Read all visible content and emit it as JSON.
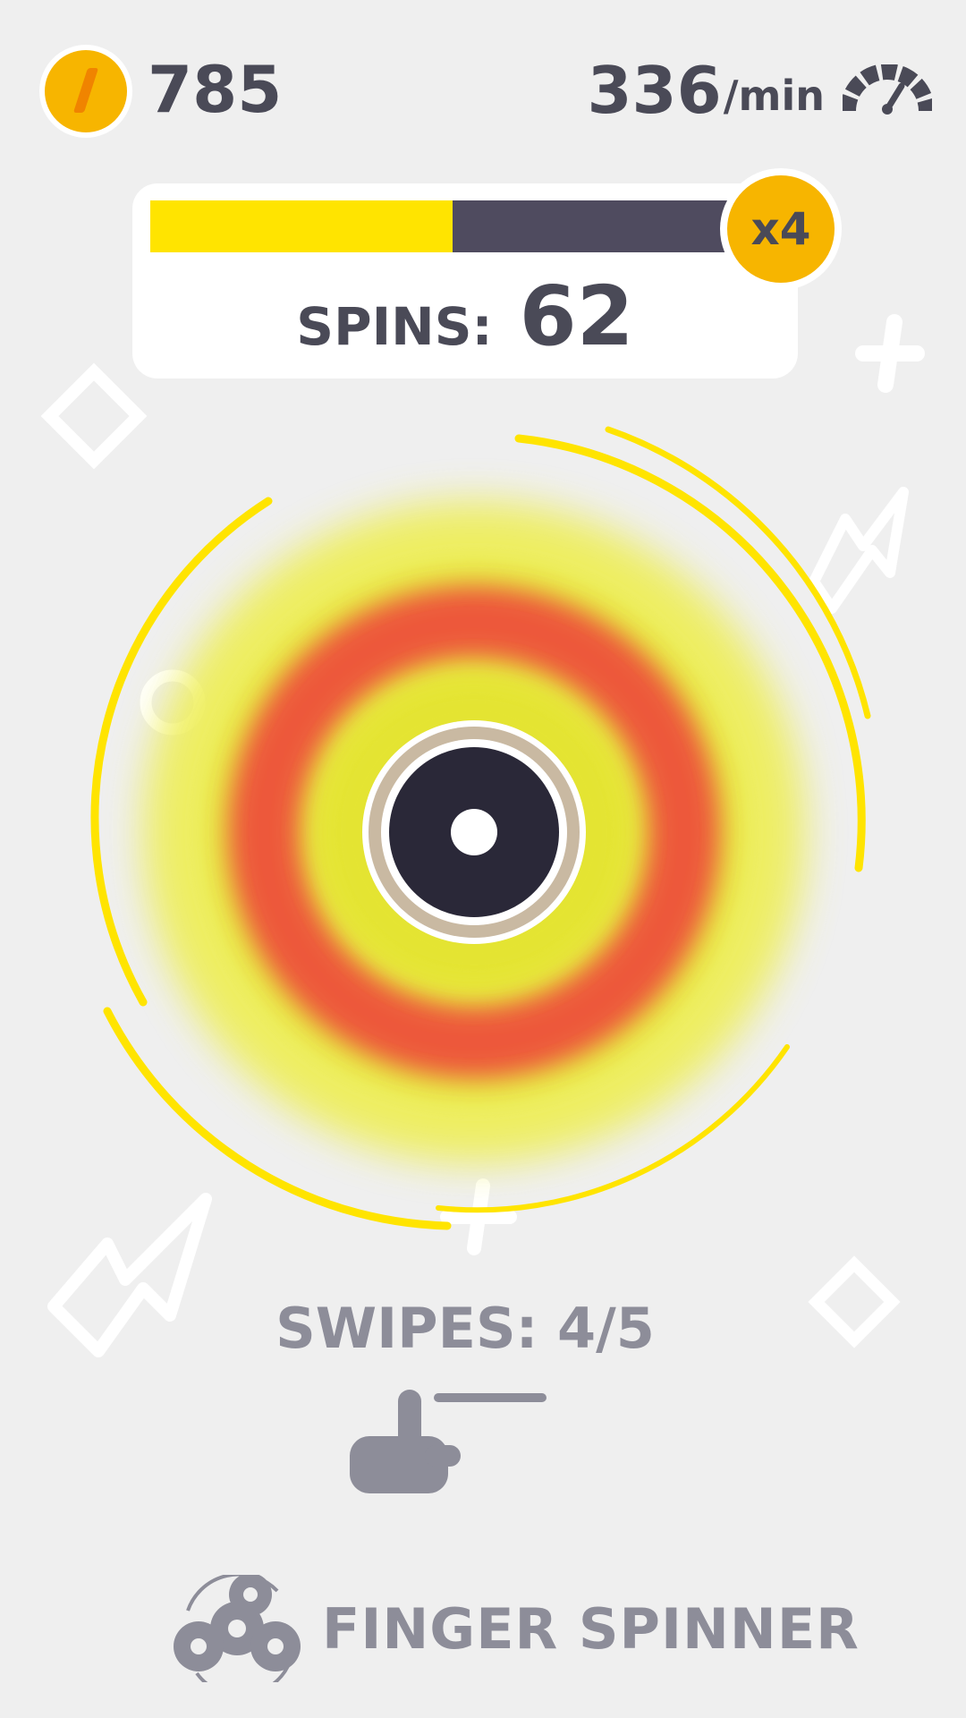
{
  "hud": {
    "coins": "785",
    "speed_value": "336",
    "speed_unit": "/min",
    "coin_icon": "coin-icon",
    "speed_icon": "speedometer-icon"
  },
  "progress": {
    "fill_fraction": 0.52,
    "multiplier": "x4",
    "spins_label": "SPINS:",
    "spins_value": "62"
  },
  "game": {
    "swipes_label": "SWIPES: 4/5",
    "hint_icon": "swipe-hand-icon"
  },
  "brand": {
    "name": "FINGER SPINNER",
    "logo_icon": "fidget-spinner-icon"
  },
  "colors": {
    "background": "#efefef",
    "text_dark": "#4a4a57",
    "text_muted": "#8d8d99",
    "accent_yellow": "#ffe400",
    "coin_orange": "#f7b500",
    "spinner_red": "#e94b3c",
    "track_dark": "#4f4b5f"
  }
}
